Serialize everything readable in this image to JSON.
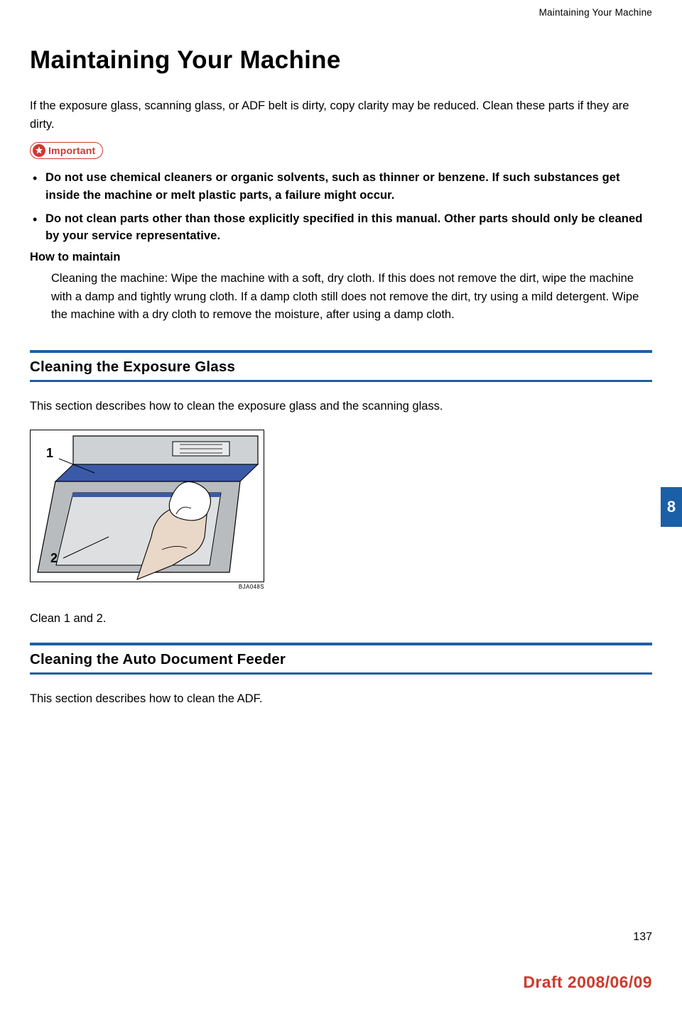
{
  "header": {
    "running": "Maintaining Your Machine"
  },
  "title": "Maintaining Your Machine",
  "intro": "If the exposure glass, scanning glass, or ADF belt is dirty, copy clarity may be reduced. Clean these parts if they are dirty.",
  "important": {
    "label": "Important",
    "items": [
      "Do not use chemical cleaners or organic solvents, such as thinner or benzene. If such substances get inside the machine or melt plastic parts, a failure might occur.",
      "Do not clean parts other than those explicitly specified in this manual. Other parts should only be cleaned by your service representative."
    ]
  },
  "howto": {
    "heading": "How to maintain",
    "body": "Cleaning the machine: Wipe the machine with a soft, dry cloth. If this does not remove the dirt, wipe the machine with a damp and tightly wrung cloth. If a damp cloth still does not remove the dirt, try using a mild detergent. Wipe the machine with a dry cloth to remove the moisture, after using a damp cloth."
  },
  "sections": {
    "exposure": {
      "heading": "Cleaning the Exposure Glass",
      "desc": "This section describes how to clean the exposure glass and the scanning glass.",
      "fig_labels": {
        "one": "1",
        "two": "2"
      },
      "fig_id": "BJA048S",
      "caption": "Clean 1 and 2."
    },
    "adf": {
      "heading": "Cleaning the Auto Document Feeder",
      "desc": "This section describes how to clean the ADF."
    }
  },
  "tab": "8",
  "page_number": "137",
  "draft": "Draft 2008/06/09"
}
